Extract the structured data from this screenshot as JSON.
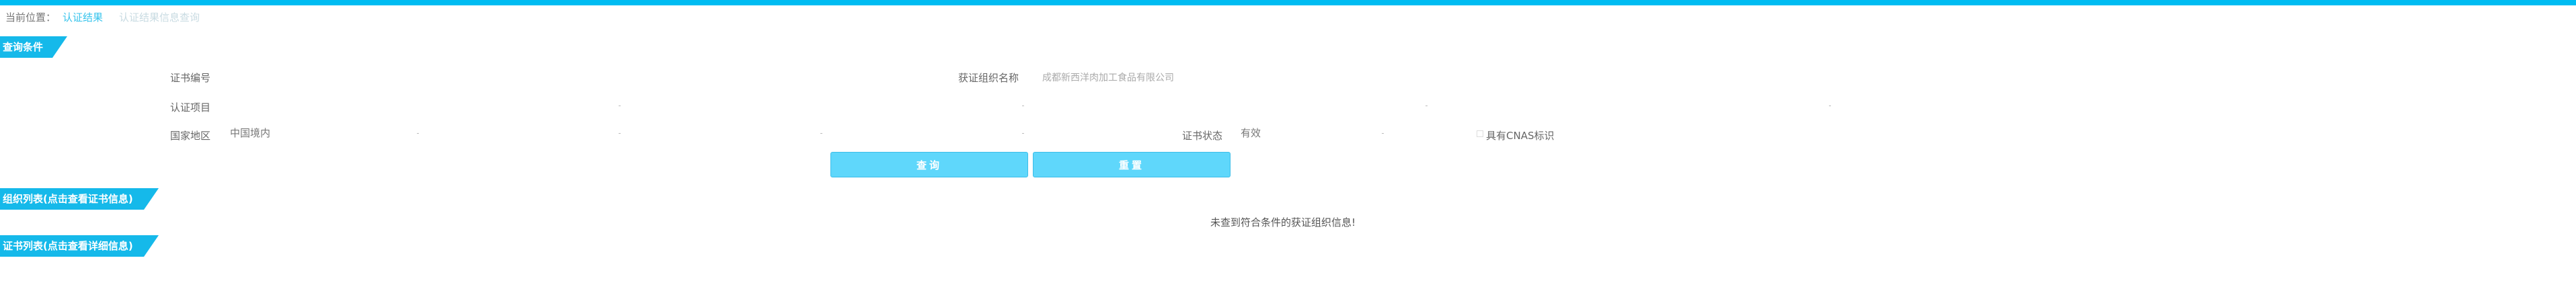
{
  "breadcrumb": {
    "location_label": "当前位置：",
    "active": "认证结果",
    "current": "认证结果信息查询"
  },
  "sections": {
    "query": "查询条件",
    "org_list": "组织列表(点击查看证书信息)",
    "cert_list": "证书列表(点击查看详细信息)"
  },
  "form": {
    "cert_no_label": "证书编号",
    "org_name_label": "获证组织名称",
    "org_name_placeholder": "成都新西洋肉加工食品有限公司",
    "cert_project_label": "认证项目",
    "region_label": "国家地区",
    "region_value": "中国境内",
    "status_label": "证书状态",
    "status_value": "有效",
    "cnas_label": "具有CNAS标识"
  },
  "buttons": {
    "search": "查询",
    "reset": "重置"
  },
  "org_list": {
    "empty_message": "未查到符合条件的获证组织信息!"
  }
}
